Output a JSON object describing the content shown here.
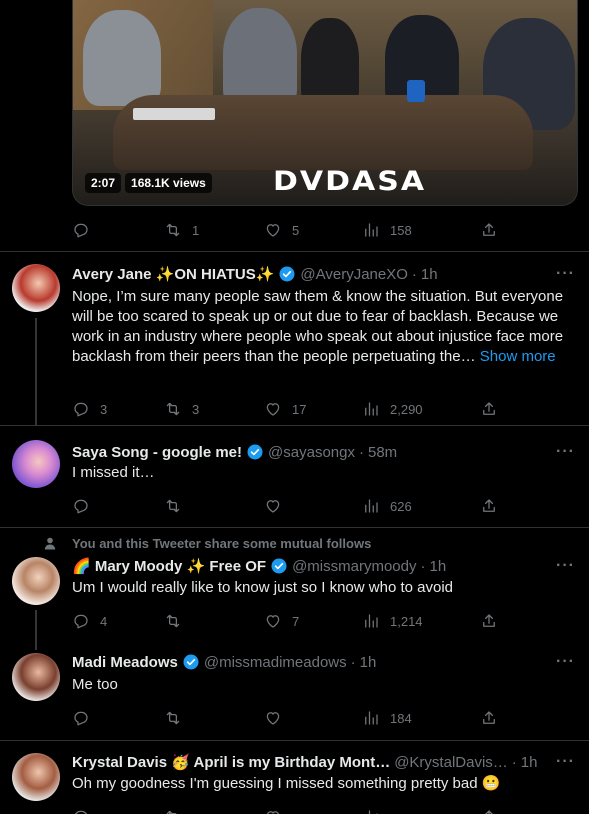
{
  "colors": {
    "background": "#000000",
    "text": "#e7e9ea",
    "muted": "#71767b",
    "border": "#2f3336",
    "link": "#1d9bf0",
    "verified": "#1d9bf0"
  },
  "video": {
    "duration": "2:07",
    "views": "168.1K views",
    "logo_text": "DVDASA",
    "actions": {
      "replies": "",
      "retweets": "1",
      "likes": "5",
      "views": "158"
    }
  },
  "tweets": [
    {
      "name": "Avery Jane ✨ON HIATUS✨",
      "handle": "@AveryJaneXO",
      "time": "1h",
      "text": "Nope, I’m sure many people saw them & know the situation. But everyone will be too scared to speak up or out due to fear of backlash. Because we work in an industry where people who speak out about injustice face more backlash from their peers than the people perpetuating the…",
      "show_more": "Show more",
      "avatar_icon": "avatar-photo",
      "actions": {
        "replies": "3",
        "retweets": "3",
        "likes": "17",
        "views": "2,290"
      }
    },
    {
      "name": "Saya Song - google me!",
      "handle": "@sayasongx",
      "time": "58m",
      "text": "I missed it…",
      "avatar_icon": "avatar-photo",
      "actions": {
        "replies": "",
        "retweets": "",
        "likes": "",
        "views": "626"
      }
    },
    {
      "mutual_text": "You and this Tweeter share some mutual follows",
      "name": "🌈 Mary Moody ✨ Free OF",
      "handle": "@missmarymoody",
      "time": "1h",
      "text": "Um I would really like to know just so I know who to avoid",
      "avatar_icon": "avatar-photo",
      "actions": {
        "replies": "4",
        "retweets": "",
        "likes": "7",
        "views": "1,214"
      }
    },
    {
      "name": "Madi Meadows",
      "handle": "@missmadimeadows",
      "time": "1h",
      "text": "Me too",
      "avatar_icon": "avatar-photo",
      "actions": {
        "replies": "",
        "retweets": "",
        "likes": "",
        "views": "184"
      }
    },
    {
      "name": "Krystal Davis 🥳 April is my Birthday Mont…",
      "handle": "@KrystalDavis…",
      "time": "1h",
      "text": "Oh my goodness I'm guessing I missed something pretty bad 😬",
      "avatar_icon": "avatar-photo",
      "actions": {
        "replies": "",
        "retweets": "",
        "likes": "",
        "views": ""
      }
    }
  ],
  "icons": {
    "reply": "reply-icon",
    "retweet": "retweet-icon",
    "like": "heart-icon",
    "views": "views-icon",
    "share": "share-icon",
    "verified": "verified-icon",
    "more": "more-icon",
    "mutual": "person-icon"
  },
  "ui": {
    "more_glyph": "···",
    "dot": "·"
  }
}
